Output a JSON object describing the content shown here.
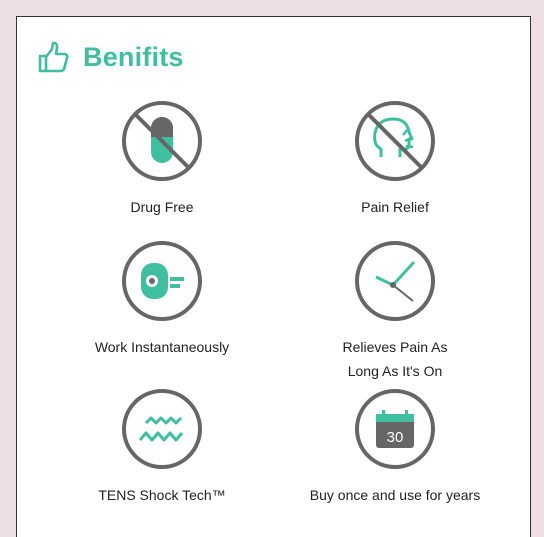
{
  "header": {
    "title": "Benifits",
    "icon": "thumbs-up-icon"
  },
  "colors": {
    "accent": "#3fbfa0",
    "ring": "#666666"
  },
  "benefits": [
    {
      "label": "Drug Free",
      "icon": "no-pill-icon"
    },
    {
      "label": "Pain Relief",
      "icon": "no-pain-head-icon"
    },
    {
      "label": "Work Instantaneously",
      "icon": "device-icon"
    },
    {
      "label": "Relieves Pain As",
      "label2": "Long As It's On",
      "icon": "clock-icon"
    },
    {
      "label": "TENS Shock Tech™",
      "icon": "wave-icon"
    },
    {
      "label": "Buy once and use for years",
      "icon": "calendar-icon",
      "calendar_number": "30"
    }
  ]
}
